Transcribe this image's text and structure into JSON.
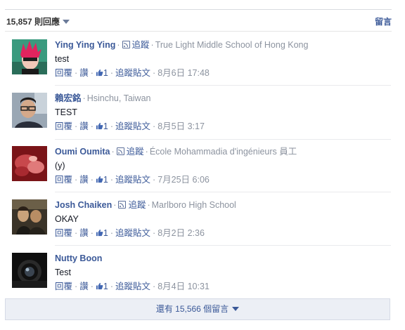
{
  "header": {
    "comment_count": "15,857 則回應",
    "post_link": "留言"
  },
  "comments": [
    {
      "name": "Ying Ying Ying",
      "follow": "追蹤",
      "affiliation": "True Light Middle School of Hong Kong",
      "text": "test",
      "reply": "回覆",
      "like": "讚",
      "likes": "1",
      "follow_post": "追蹤貼文",
      "time": "8月6日 17:48"
    },
    {
      "name": "賴宏銘",
      "follow": "",
      "affiliation": "Hsinchu, Taiwan",
      "text": "TEST",
      "reply": "回覆",
      "like": "讚",
      "likes": "1",
      "follow_post": "追蹤貼文",
      "time": "8月5日 3:17"
    },
    {
      "name": "Oumi Oumita",
      "follow": "追蹤",
      "affiliation": "École Mohammadia d'ingénieurs 員工",
      "text": "(y)",
      "reply": "回覆",
      "like": "讚",
      "likes": "1",
      "follow_post": "追蹤貼文",
      "time": "7月25日 6:06"
    },
    {
      "name": "Josh Chaiken",
      "follow": "追蹤",
      "affiliation": "Marlboro High School",
      "text": "OKAY",
      "reply": "回覆",
      "like": "讚",
      "likes": "1",
      "follow_post": "追蹤貼文",
      "time": "8月2日 2:36"
    },
    {
      "name": "Nutty Boon",
      "follow": "",
      "affiliation": "",
      "text": "Test",
      "reply": "回覆",
      "like": "讚",
      "likes": "1",
      "follow_post": "追蹤貼文",
      "time": "8月4日 10:31"
    }
  ],
  "footer": {
    "more_comments": "還有 15,566 個留言"
  },
  "icons": {
    "follow": "rss-icon",
    "likes": "thumbs-up-icon",
    "dropdown": "caret-down-icon"
  },
  "colors": {
    "link": "#3b5998",
    "meta": "#8c939f",
    "more_bar": "#eceff5"
  }
}
